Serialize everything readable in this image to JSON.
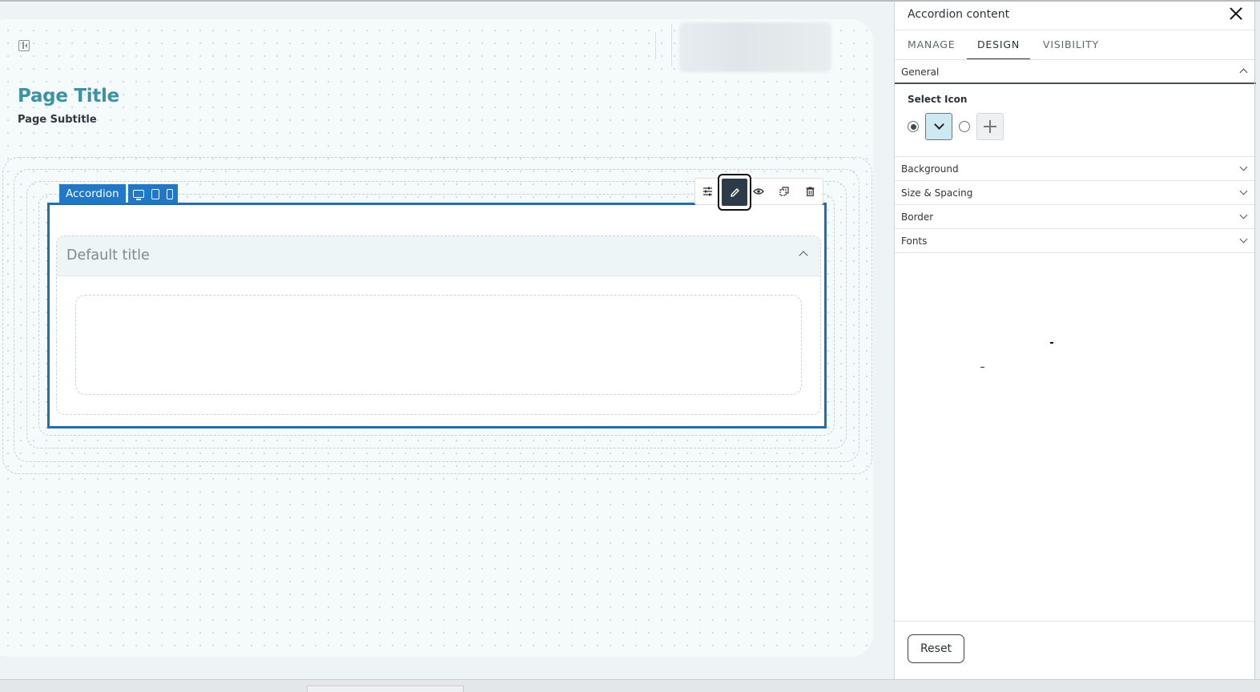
{
  "canvas": {
    "page_title": "Page Title",
    "page_subtitle": "Page Subtitle",
    "accordion": {
      "tag_label": "Accordion",
      "device_icons": [
        "desktop-icon",
        "tablet-icon",
        "mobile-icon"
      ],
      "item_title": "Default title",
      "expanded": true
    },
    "toolbar": {
      "items": [
        "settings-sliders-icon",
        "pencil-icon",
        "eye-icon",
        "duplicate-icon",
        "trash-icon"
      ],
      "active": "pencil-icon"
    }
  },
  "panel": {
    "title": "Accordion content",
    "tabs": [
      {
        "label": "MANAGE",
        "active": false
      },
      {
        "label": "DESIGN",
        "active": true
      },
      {
        "label": "VISIBILITY",
        "active": false
      }
    ],
    "sections": {
      "general": {
        "label": "General",
        "expanded": true,
        "select_icon_label": "Select Icon",
        "icon_options": [
          {
            "icon": "chevron-down-icon",
            "selected": true
          },
          {
            "icon": "plus-icon",
            "selected": false
          }
        ]
      },
      "collapsed": [
        {
          "label": "Background"
        },
        {
          "label": "Size & Spacing"
        },
        {
          "label": "Border"
        },
        {
          "label": "Fonts"
        }
      ]
    },
    "reset_label": "Reset"
  },
  "colors": {
    "accent_blue": "#1f78c8",
    "frame_blue": "#1e6eb3",
    "title_teal": "#3a94a6",
    "edit_active": "#2d3a4a",
    "selected_icon_bg": "#cfe9f3"
  }
}
